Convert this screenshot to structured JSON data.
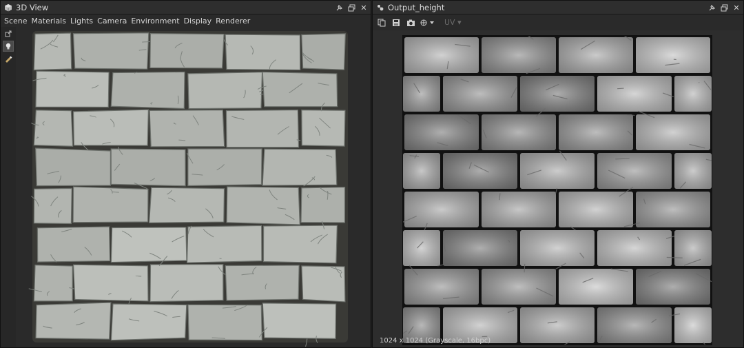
{
  "left_panel": {
    "title": "3D View",
    "menu": [
      "Scene",
      "Materials",
      "Lights",
      "Camera",
      "Environment",
      "Display",
      "Renderer"
    ]
  },
  "right_panel": {
    "title": "Output_height",
    "uv_label": "UV",
    "status": "1024 x 1024 (Grayscale, 16bpc)"
  },
  "colors": {
    "stone_light": "#b7bbb6",
    "stone_dark": "#8f948f",
    "height_white": "#e6e6e6",
    "height_dark": "#5a5a5a"
  }
}
